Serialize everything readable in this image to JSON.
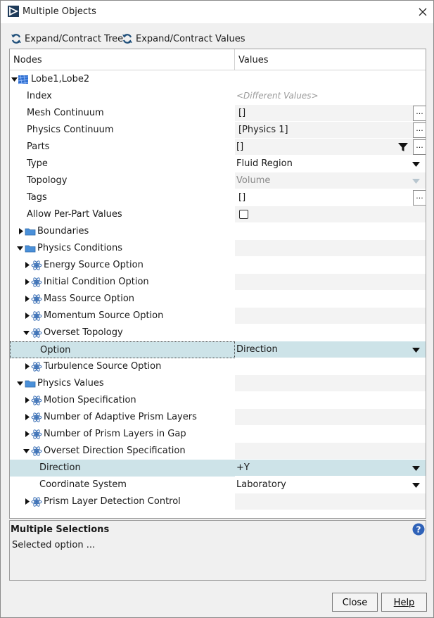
{
  "window": {
    "title": "Multiple Objects"
  },
  "toolbar": {
    "expand_tree": "Expand/Contract Tree",
    "expand_values": "Expand/Contract Values"
  },
  "columns": {
    "nodes": "Nodes",
    "values": "Values"
  },
  "rows": [
    {
      "label": "Lobe1,Lobe2",
      "value": ""
    },
    {
      "label": "Index",
      "value": "<Different Values>"
    },
    {
      "label": "Mesh Continuum",
      "value": "[]"
    },
    {
      "label": "Physics Continuum",
      "value": "[Physics 1]"
    },
    {
      "label": "Parts",
      "value": "[]"
    },
    {
      "label": "Type",
      "value": "Fluid Region"
    },
    {
      "label": "Topology",
      "value": "Volume"
    },
    {
      "label": "Tags",
      "value": "[]"
    },
    {
      "label": "Allow Per-Part Values",
      "value": ""
    },
    {
      "label": "Boundaries",
      "value": ""
    },
    {
      "label": "Physics Conditions",
      "value": ""
    },
    {
      "label": "Energy Source Option",
      "value": ""
    },
    {
      "label": "Initial Condition Option",
      "value": ""
    },
    {
      "label": "Mass Source Option",
      "value": ""
    },
    {
      "label": "Momentum Source Option",
      "value": ""
    },
    {
      "label": "Overset Topology",
      "value": ""
    },
    {
      "label": "Option",
      "value": "Direction"
    },
    {
      "label": "Turbulence Source Option",
      "value": ""
    },
    {
      "label": "Physics Values",
      "value": ""
    },
    {
      "label": "Motion Specification",
      "value": ""
    },
    {
      "label": "Number of Adaptive Prism Layers",
      "value": ""
    },
    {
      "label": "Number of Prism Layers in Gap",
      "value": ""
    },
    {
      "label": "Overset Direction Specification",
      "value": ""
    },
    {
      "label": "Direction",
      "value": "+Y"
    },
    {
      "label": "Coordinate System",
      "value": "Laboratory"
    },
    {
      "label": "Prism Layer Detection Control",
      "value": ""
    }
  ],
  "ellipsis": "...",
  "description": {
    "title": "Multiple Selections",
    "text": "Selected option ..."
  },
  "buttons": {
    "close": "Close",
    "help": "Help"
  },
  "colors": {
    "selected_row": "#cde3e8",
    "folder": "#4a90d9",
    "icon": "#3a6fb5"
  }
}
